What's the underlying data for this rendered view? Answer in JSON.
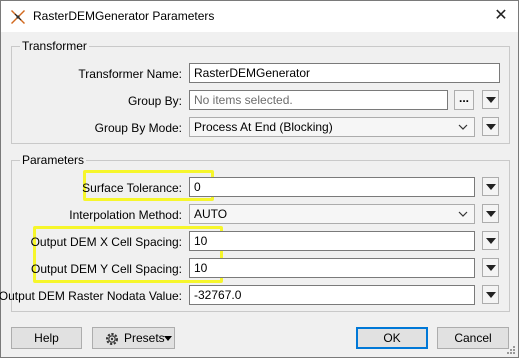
{
  "window": {
    "title": "RasterDEMGenerator Parameters"
  },
  "transformer": {
    "legend": "Transformer",
    "name_label": "Transformer Name:",
    "name_value": "RasterDEMGenerator",
    "group_by_label": "Group By:",
    "group_by_placeholder": "No items selected.",
    "group_by_button": "...",
    "group_by_mode_label": "Group By Mode:",
    "group_by_mode_value": "Process At End (Blocking)"
  },
  "parameters": {
    "legend": "Parameters",
    "surface_tolerance_label": "Surface Tolerance:",
    "surface_tolerance_value": "0",
    "interpolation_label": "Interpolation Method:",
    "interpolation_value": "AUTO",
    "x_spacing_label": "Output DEM X Cell Spacing:",
    "x_spacing_value": "10",
    "y_spacing_label": "Output DEM Y Cell Spacing:",
    "y_spacing_value": "10",
    "nodata_label": "Output DEM Raster Nodata Value:",
    "nodata_value": "-32767.0"
  },
  "footer": {
    "help_label": "Help",
    "presets_label": "Presets",
    "ok_label": "OK",
    "cancel_label": "Cancel"
  },
  "colors": {
    "highlight": "#f6f62b",
    "ok_border": "#0078d7"
  }
}
